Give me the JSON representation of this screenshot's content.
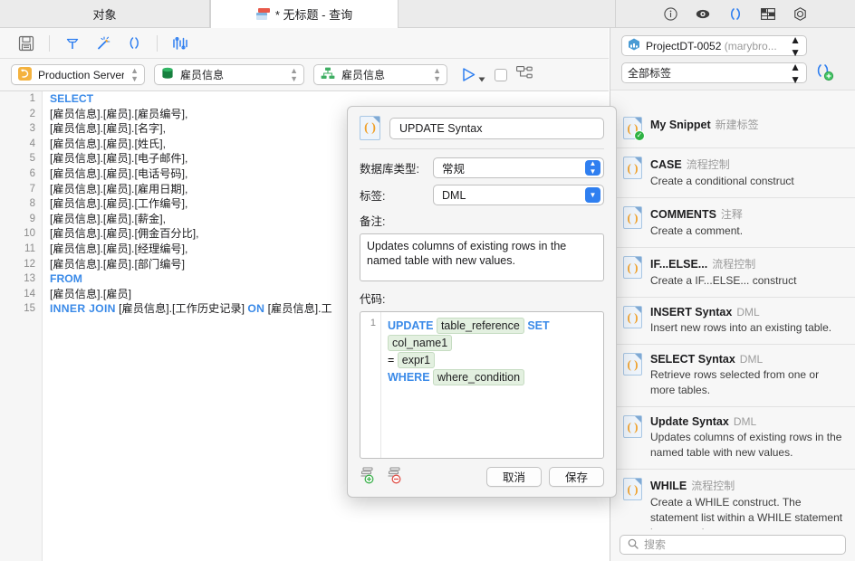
{
  "window": {
    "tabs": [
      {
        "label": "对象",
        "icon": "none",
        "active": false
      },
      {
        "label": "* 无标题 - 查询",
        "icon": "query-table-icon",
        "active": true
      }
    ],
    "right_icons": [
      "info-icon",
      "eye-icon",
      "parentheses-icon",
      "table-grid-icon",
      "gear-hex-icon"
    ]
  },
  "toolbar": {
    "icons": [
      "save-icon",
      "hammer-icon",
      "magic-wand-icon",
      "parentheses-icon",
      "chart-bars-icon"
    ]
  },
  "connection_bar": {
    "server": "Production Server",
    "database": "雇员信息",
    "schema": "雇员信息",
    "run_label": "run-query",
    "icons": [
      "run-triangle-icon",
      "stop-checkbox-icon",
      "explain-plan-icon"
    ]
  },
  "sql_editor": {
    "line_numbers": [
      "1",
      "2",
      "3",
      "4",
      "5",
      "6",
      "7",
      "8",
      "9",
      "10",
      "11",
      "12",
      "13",
      "14",
      "15"
    ],
    "lines": [
      {
        "kw": "SELECT",
        "text": ""
      },
      {
        "kw": "",
        "text": "[雇员信息].[雇员].[雇员编号],"
      },
      {
        "kw": "",
        "text": "[雇员信息].[雇员].[名字],"
      },
      {
        "kw": "",
        "text": "[雇员信息].[雇员].[姓氏],"
      },
      {
        "kw": "",
        "text": "[雇员信息].[雇员].[电子邮件],"
      },
      {
        "kw": "",
        "text": "[雇员信息].[雇员].[电话号码],"
      },
      {
        "kw": "",
        "text": "[雇员信息].[雇员].[雇用日期],"
      },
      {
        "kw": "",
        "text": "[雇员信息].[雇员].[工作编号],"
      },
      {
        "kw": "",
        "text": "[雇员信息].[雇员].[薪金],"
      },
      {
        "kw": "",
        "text": "[雇员信息].[雇员].[佣金百分比],"
      },
      {
        "kw": "",
        "text": "[雇员信息].[雇员].[经理编号],"
      },
      {
        "kw": "",
        "text": "[雇员信息].[雇员].[部门编号]"
      },
      {
        "kw": "FROM",
        "text": ""
      },
      {
        "kw": "",
        "text": "[雇员信息].[雇员]"
      },
      {
        "kw": "INNER JOIN",
        "text": "  [雇员信息].[工作历史记录]  ",
        "kw_mid": "ON",
        "text2": "  [雇员信息].工"
      }
    ]
  },
  "dialog": {
    "icon": "snippet-doc-icon",
    "title_value": "UPDATE Syntax",
    "db_type_label": "数据库类型:",
    "db_type_value": "常规",
    "tag_label": "标签:",
    "tag_value": "DML",
    "notes_label": "备注:",
    "notes_value": "Updates columns of existing rows in the named table with new values.",
    "code_label": "代码:",
    "code_line_no": "1",
    "code": {
      "tok1": "UPDATE",
      "chip1": "table_reference",
      "tok2": "SET",
      "chip2": "col_name1",
      "eq": "=",
      "chip3": "expr1",
      "tok3": "WHERE",
      "chip4": "where_condition"
    },
    "add_param_icon": "add-parameter-icon",
    "remove_param_icon": "remove-parameter-icon",
    "cancel_label": "取消",
    "save_label": "保存"
  },
  "sidebar": {
    "project_value": "ProjectDT-0052",
    "project_suffix": "(marybro...",
    "tag_filter_value": "全部标签",
    "add_snippet_icon": "add-snippet-icon",
    "search_placeholder": "搜索",
    "search_value": "",
    "snippets": [
      {
        "name": "My Snippet",
        "category": "新建标签",
        "desc": "",
        "selected": true
      },
      {
        "name": "CASE",
        "category": "流程控制",
        "desc": "Create a conditional construct",
        "selected": false
      },
      {
        "name": "COMMENTS",
        "category": "注释",
        "desc": "Create a comment.",
        "selected": false
      },
      {
        "name": "IF...ELSE...",
        "category": "流程控制",
        "desc": "Create a IF...ELSE... construct",
        "selected": false
      },
      {
        "name": "INSERT Syntax",
        "category": "DML",
        "desc": "Insert new rows into an existing table.",
        "selected": false
      },
      {
        "name": "SELECT Syntax",
        "category": "DML",
        "desc": "Retrieve rows selected from one or more tables.",
        "selected": false
      },
      {
        "name": "Update Syntax",
        "category": "DML",
        "desc": "Updates columns of existing rows in the named table with new values.",
        "selected": false
      },
      {
        "name": "WHILE",
        "category": "流程控制",
        "desc": "Create a WHILE construct. The statement list within a WHILE statement is repeated",
        "selected": false
      }
    ]
  },
  "colors": {
    "accent_blue": "#3a8ae8",
    "chip_green": "#e3f0e0",
    "window_bg": "#f5f5f5",
    "sidebar_bg": "#f7f7f7"
  }
}
